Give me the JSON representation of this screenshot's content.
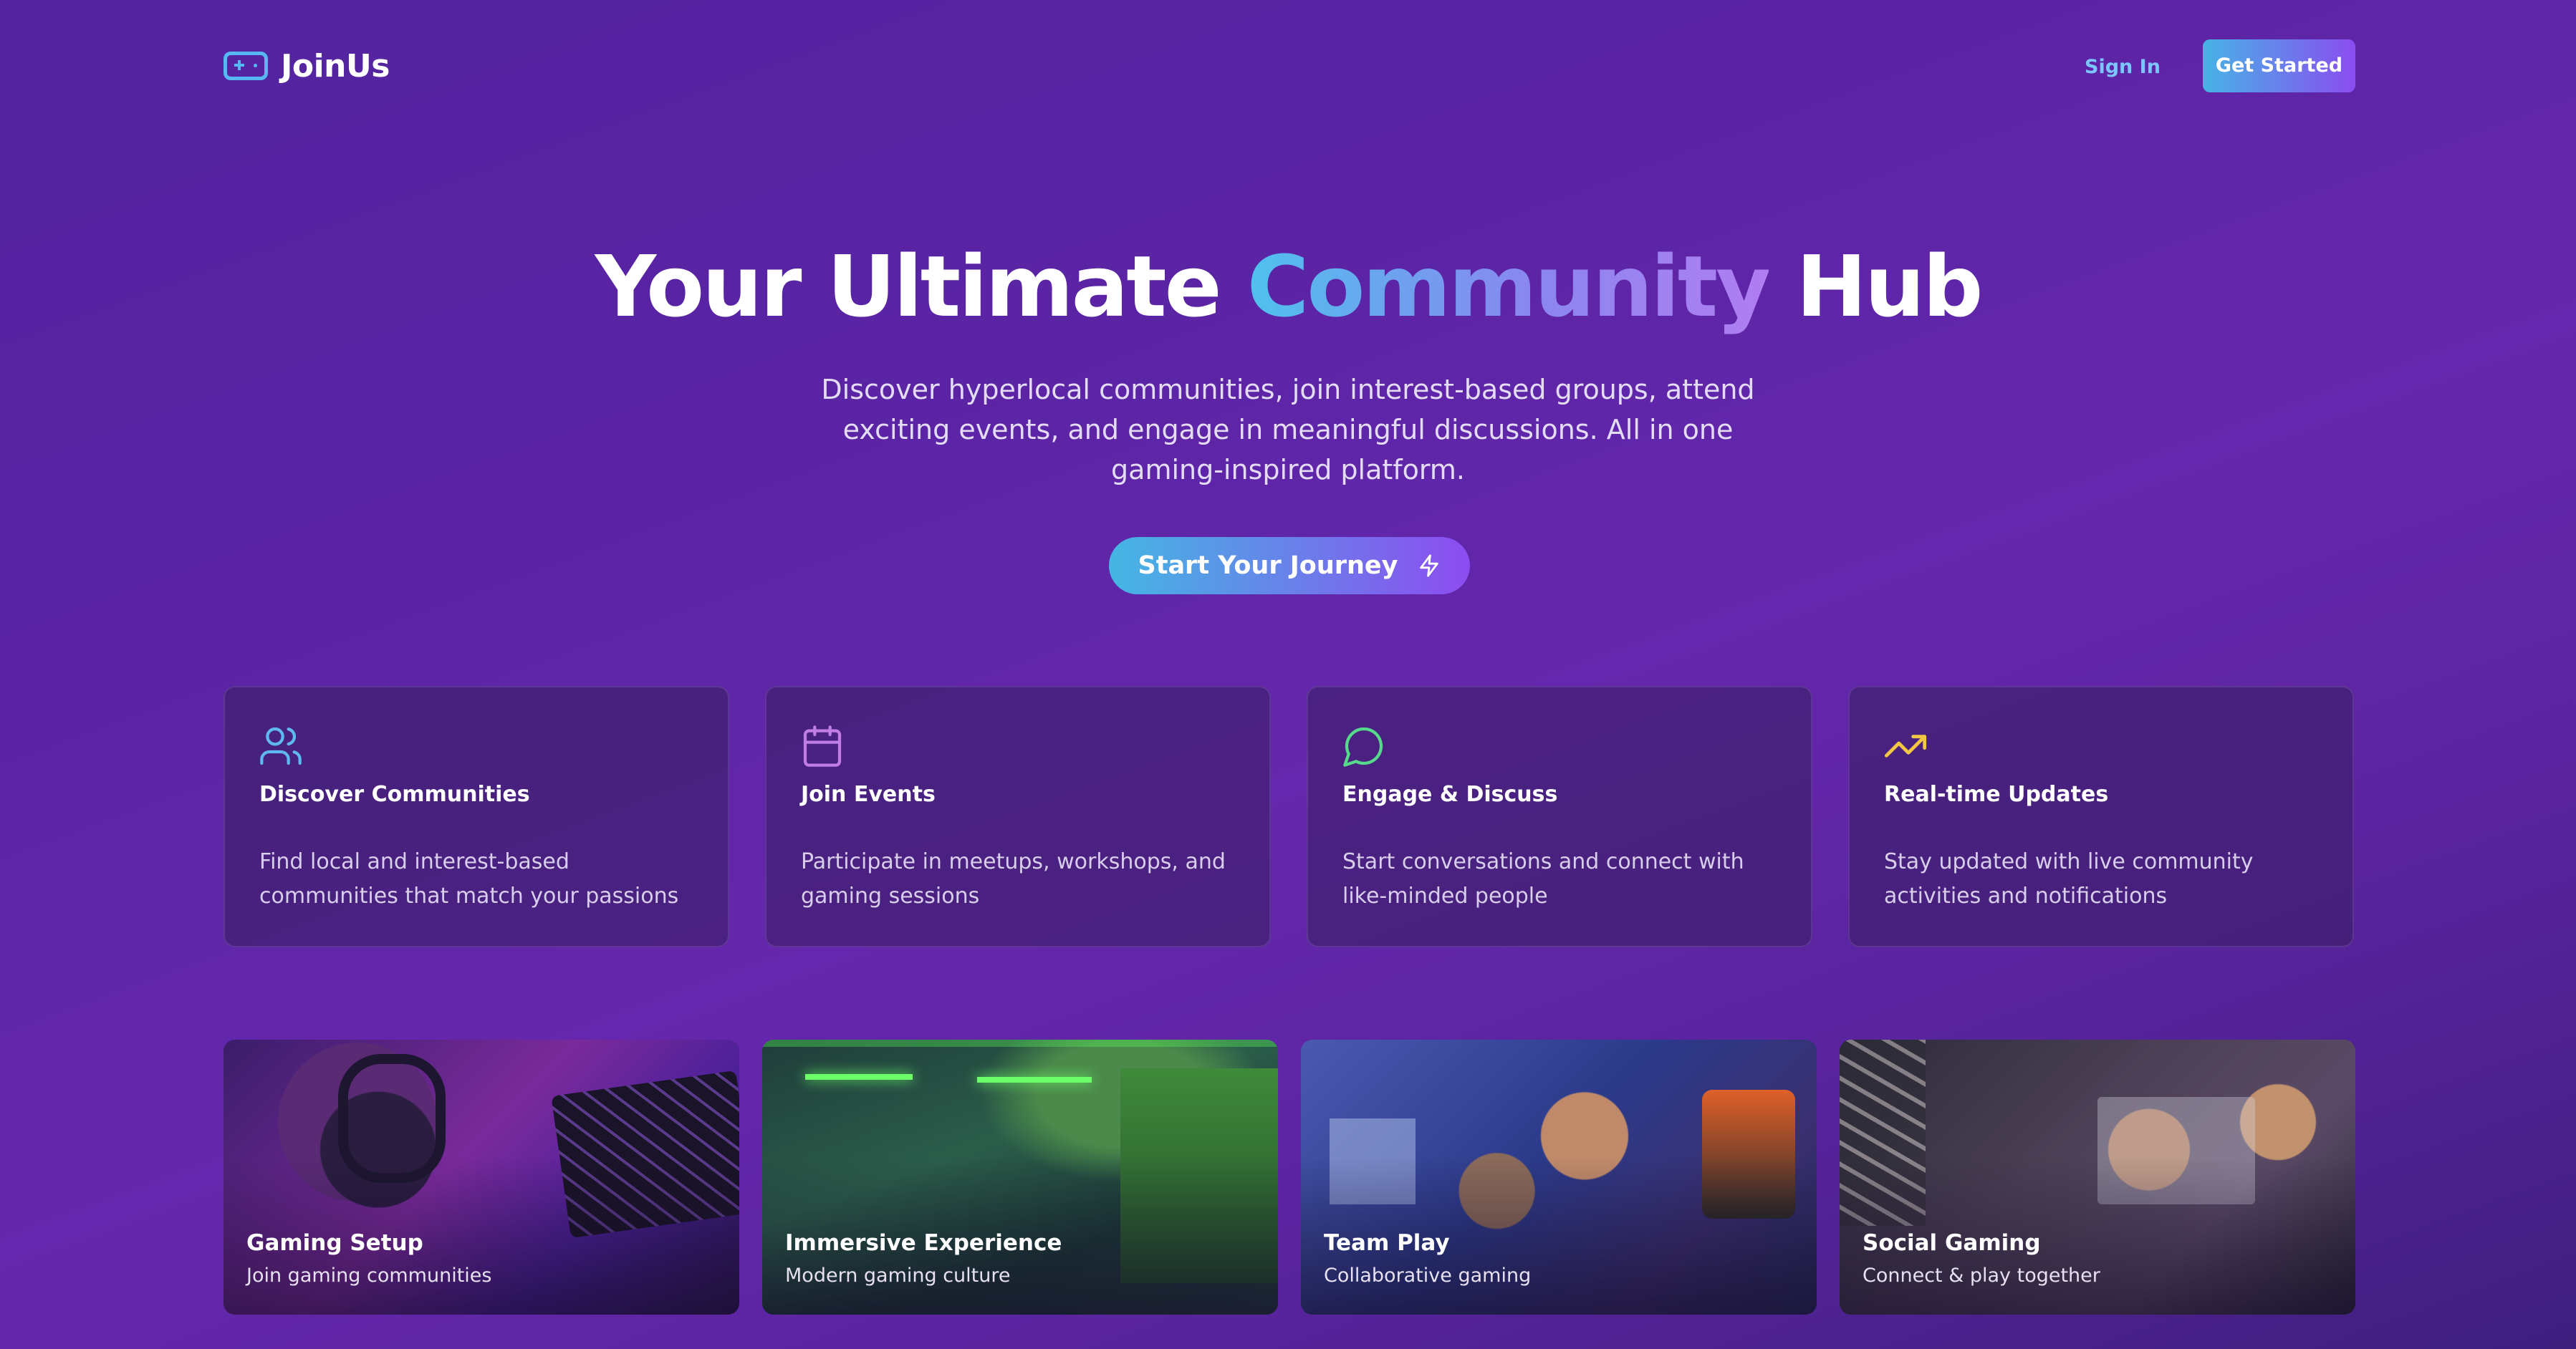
{
  "nav": {
    "logo_text": "JoinUs",
    "sign_in": "Sign In",
    "get_started": "Get Started"
  },
  "hero": {
    "title_part1": "Your Ultimate ",
    "title_highlight": "Community",
    "title_part2": " Hub",
    "subtitle": "Discover hyperlocal communities, join interest-based groups, attend exciting events, and engage in meaningful discussions. All in one gaming-inspired platform.",
    "cta_label": "Start Your Journey",
    "cta_icon": "lightning-icon"
  },
  "features": [
    {
      "icon": "users-icon",
      "icon_color": "#5fb8f0",
      "title": "Discover Communities",
      "description": "Find local and interest-based communities that match your passions"
    },
    {
      "icon": "calendar-icon",
      "icon_color": "#c07de6",
      "title": "Join Events",
      "description": "Participate in meetups, workshops, and gaming sessions"
    },
    {
      "icon": "chat-bubble-icon",
      "icon_color": "#56d98a",
      "title": "Engage & Discuss",
      "description": "Start conversations and connect with like-minded people"
    },
    {
      "icon": "trending-up-icon",
      "icon_color": "#f2c744",
      "title": "Real-time Updates",
      "description": "Stay updated with live community activities and notifications"
    }
  ],
  "gallery": [
    {
      "title": "Gaming Setup",
      "subtitle": "Join gaming communities"
    },
    {
      "title": "Immersive Experience",
      "subtitle": "Modern gaming culture"
    },
    {
      "title": "Team Play",
      "subtitle": "Collaborative gaming"
    },
    {
      "title": "Social Gaming",
      "subtitle": "Connect & play together"
    }
  ]
}
